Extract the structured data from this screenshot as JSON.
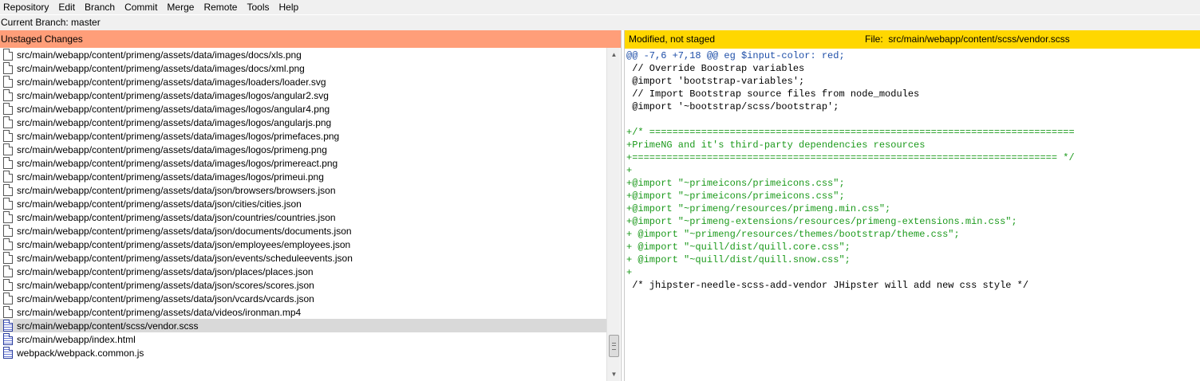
{
  "menubar": {
    "items": [
      "Repository",
      "Edit",
      "Branch",
      "Commit",
      "Merge",
      "Remote",
      "Tools",
      "Help"
    ]
  },
  "branch": {
    "label": "Current Branch: master"
  },
  "unstaged": {
    "header": "Unstaged Changes",
    "files": [
      "src/main/webapp/content/primeng/assets/data/images/docs/xls.png",
      "src/main/webapp/content/primeng/assets/data/images/docs/xml.png",
      "src/main/webapp/content/primeng/assets/data/images/loaders/loader.svg",
      "src/main/webapp/content/primeng/assets/data/images/logos/angular2.svg",
      "src/main/webapp/content/primeng/assets/data/images/logos/angular4.png",
      "src/main/webapp/content/primeng/assets/data/images/logos/angularjs.png",
      "src/main/webapp/content/primeng/assets/data/images/logos/primefaces.png",
      "src/main/webapp/content/primeng/assets/data/images/logos/primeng.png",
      "src/main/webapp/content/primeng/assets/data/images/logos/primereact.png",
      "src/main/webapp/content/primeng/assets/data/images/logos/primeui.png",
      "src/main/webapp/content/primeng/assets/data/json/browsers/browsers.json",
      "src/main/webapp/content/primeng/assets/data/json/cities/cities.json",
      "src/main/webapp/content/primeng/assets/data/json/countries/countries.json",
      "src/main/webapp/content/primeng/assets/data/json/documents/documents.json",
      "src/main/webapp/content/primeng/assets/data/json/employees/employees.json",
      "src/main/webapp/content/primeng/assets/data/json/events/scheduleevents.json",
      "src/main/webapp/content/primeng/assets/data/json/places/places.json",
      "src/main/webapp/content/primeng/assets/data/json/scores/scores.json",
      "src/main/webapp/content/primeng/assets/data/json/vcards/vcards.json",
      "src/main/webapp/content/primeng/assets/data/videos/ironman.mp4",
      "src/main/webapp/content/scss/vendor.scss",
      "src/main/webapp/index.html",
      "webpack/webpack.common.js"
    ],
    "modified_indices": [
      20,
      21,
      22
    ],
    "selected_index": 20,
    "icons": {
      "new": "file-icon",
      "modified": "modified-file-icon"
    }
  },
  "diff_panel": {
    "status": "Modified, not staged",
    "file_label": "File:  src/main/webapp/content/scss/vendor.scss",
    "lines": [
      {
        "type": "hunk",
        "text": "@@ -7,6 +7,18 @@ eg $input-color: red;"
      },
      {
        "type": "context",
        "text": " // Override Boostrap variables"
      },
      {
        "type": "context",
        "text": " @import 'bootstrap-variables';"
      },
      {
        "type": "context",
        "text": " // Import Bootstrap source files from node_modules"
      },
      {
        "type": "context",
        "text": " @import '~bootstrap/scss/bootstrap';"
      },
      {
        "type": "context",
        "text": ""
      },
      {
        "type": "added",
        "text": "+/* =========================================================================="
      },
      {
        "type": "added",
        "text": "+PrimeNG and it's third-party dependencies resources"
      },
      {
        "type": "added",
        "text": "+========================================================================== */"
      },
      {
        "type": "added",
        "text": "+"
      },
      {
        "type": "added",
        "text": "+@import \"~primeicons/primeicons.css\";"
      },
      {
        "type": "added",
        "text": "+@import \"~primeicons/primeicons.css\";"
      },
      {
        "type": "added",
        "text": "+@import \"~primeng/resources/primeng.min.css\";"
      },
      {
        "type": "added",
        "text": "+@import \"~primeng-extensions/resources/primeng-extensions.min.css\";"
      },
      {
        "type": "added",
        "text": "+ @import \"~primeng/resources/themes/bootstrap/theme.css\";"
      },
      {
        "type": "added",
        "text": "+ @import \"~quill/dist/quill.core.css\";"
      },
      {
        "type": "added",
        "text": "+ @import \"~quill/dist/quill.snow.css\";"
      },
      {
        "type": "added",
        "text": "+"
      },
      {
        "type": "context",
        "text": " /* jhipster-needle-scss-add-vendor JHipster will add new css style */"
      }
    ]
  },
  "colors": {
    "unstaged_header": "#ff9e79",
    "diff_header": "#ffd700",
    "added_line": "#1c9a1c",
    "hunk_line": "#1f4fa8",
    "selected_row": "#d9d9d9"
  }
}
